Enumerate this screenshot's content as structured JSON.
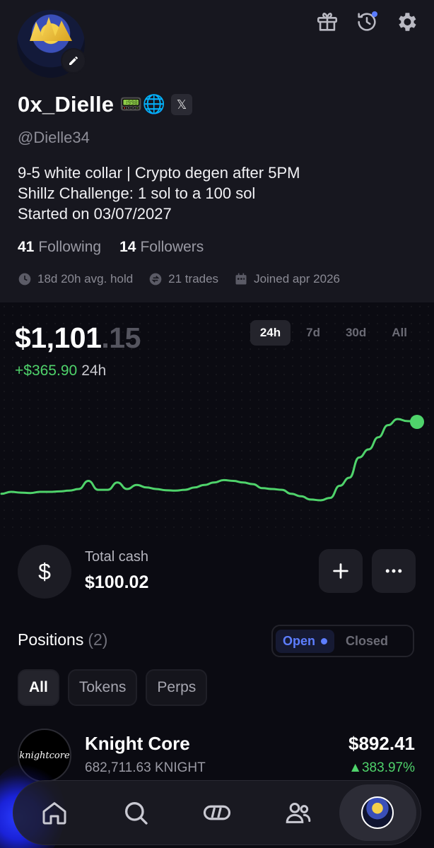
{
  "profile": {
    "name": "0x_Dielle",
    "emojis": "📟🌐",
    "x_badge": "𝕏",
    "handle": "@Dielle34",
    "bio": "9-5 white collar | Crypto degen after 5PM\nShillz Challenge: 1 sol to a 100 sol\nStarted on 03/07/2027",
    "following_count": "41",
    "following_label": "Following",
    "followers_count": "14",
    "followers_label": "Followers",
    "stats": {
      "avg_hold": "18d 20h avg. hold",
      "trades": "21 trades",
      "joined": "Joined apr 2026"
    }
  },
  "header_icons": [
    "gift-icon",
    "history-icon",
    "settings-icon"
  ],
  "portfolio": {
    "balance_main": "$1,101",
    "balance_cents": ".15",
    "change_value": "+$365.90",
    "change_period": "24h",
    "ranges": [
      "24h",
      "7d",
      "30d",
      "All"
    ],
    "active_range": "24h"
  },
  "chart_data": {
    "type": "line",
    "color": "#4fd36b",
    "values": [
      0.5,
      0.55,
      0.53,
      0.52,
      0.55,
      0.55,
      0.56,
      0.58,
      0.62,
      0.82,
      0.6,
      0.6,
      0.78,
      0.62,
      0.72,
      0.66,
      0.62,
      0.59,
      0.58,
      0.6,
      0.66,
      0.72,
      0.78,
      0.84,
      0.82,
      0.78,
      0.74,
      0.64,
      0.62,
      0.6,
      0.5,
      0.44,
      0.36,
      0.34,
      0.4,
      0.7,
      0.9,
      1.4,
      1.6,
      1.9,
      2.2,
      2.35,
      2.3,
      2.28
    ]
  },
  "cash": {
    "label": "Total cash",
    "value": "$100.02",
    "icon": "$"
  },
  "positions": {
    "title": "Positions",
    "count": "(2)",
    "toggle_open": "Open",
    "toggle_closed": "Closed",
    "filters": [
      "All",
      "Tokens",
      "Perps"
    ],
    "items": [
      {
        "logo_text": "knightcore",
        "name": "Knight Core",
        "amount": "682,711.63 KNIGHT",
        "value": "$892.41",
        "change": "▲383.97%"
      }
    ]
  },
  "nav": [
    "home-icon",
    "search-icon",
    "trade-icon",
    "users-icon",
    "profile-avatar"
  ]
}
